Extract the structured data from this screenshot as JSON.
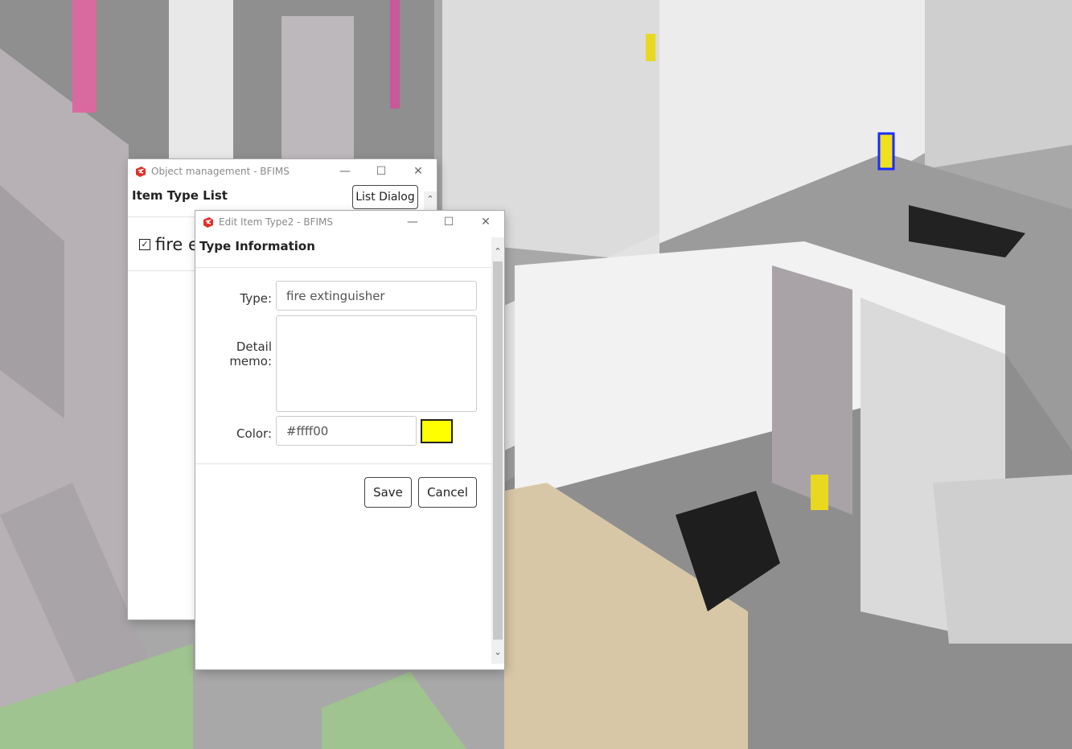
{
  "object_window": {
    "title": "Object management - BFIMS",
    "heading": "Item Type List",
    "list_dialog_button": "List Dialog",
    "items": [
      {
        "label": "fire e",
        "checked": true
      }
    ]
  },
  "edit_window": {
    "title": "Edit Item Type2 - BFIMS",
    "heading": "Type Information",
    "type_label": "Type:",
    "type_value": "fire extinguisher",
    "memo_label": "Detail memo:",
    "memo_value": "",
    "color_label": "Color:",
    "color_value": "#ffff00",
    "color_display": "#ffff00",
    "save_button": "Save",
    "cancel_button": "Cancel"
  },
  "window_controls": {
    "minimize": "—",
    "maximize": "☐",
    "close": "✕"
  },
  "colors": {
    "swatch": "#ffff00",
    "logo": "#e0302a"
  }
}
